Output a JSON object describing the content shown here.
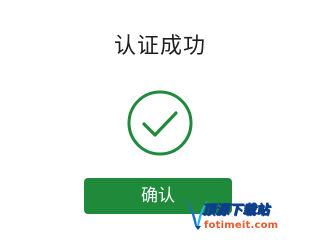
{
  "dialog": {
    "title": "认证成功",
    "status_icon": "check-circle-icon",
    "confirm_label": "确认"
  },
  "watermark": {
    "text": "顶源下载站",
    "url": "fotimeit.com"
  },
  "colors": {
    "accent": "#1e8a3a",
    "background": "#ffffff",
    "title_text": "#1f1f1f",
    "watermark_blue": "#0d3f8a",
    "watermark_orange": "#e55a2b"
  }
}
